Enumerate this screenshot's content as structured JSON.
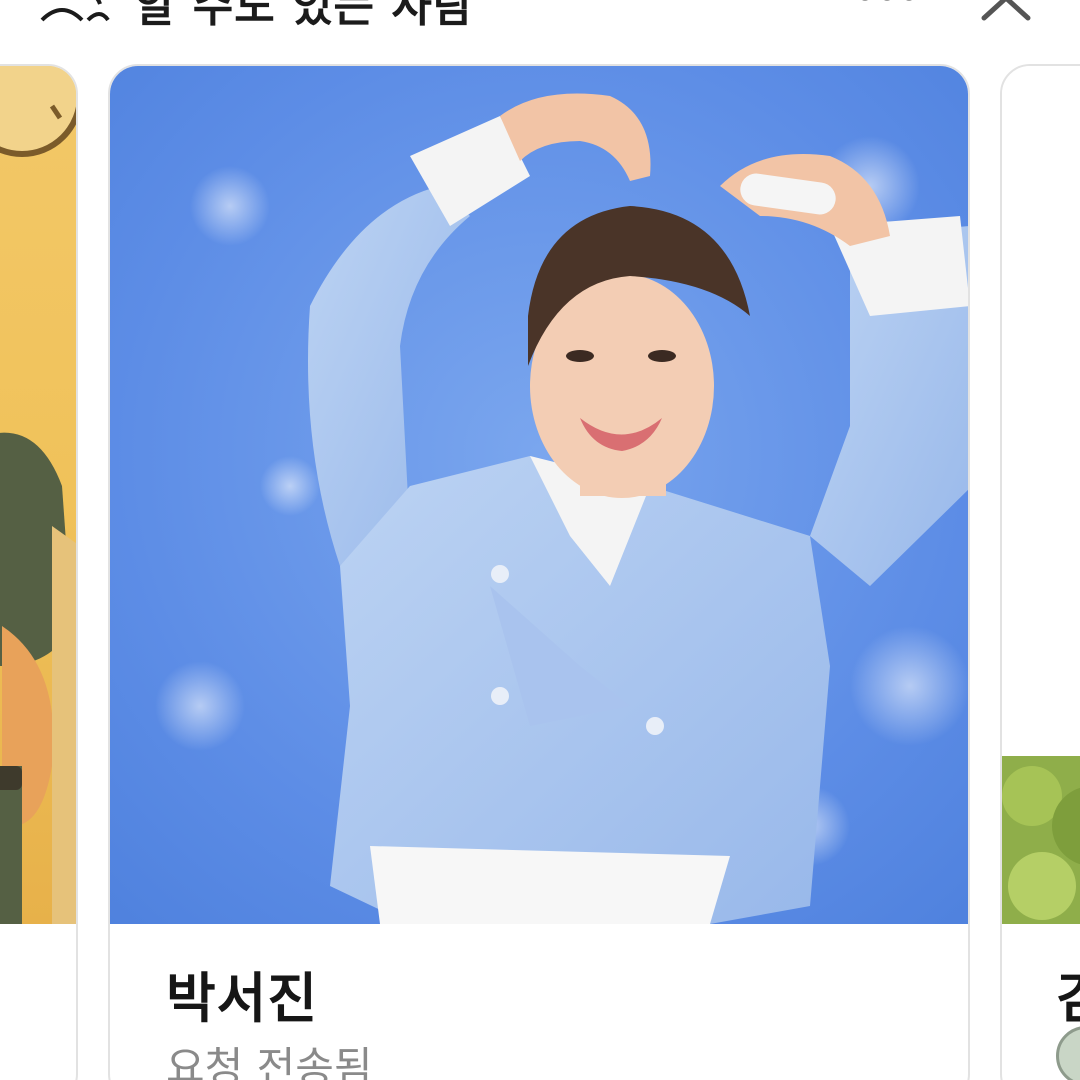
{
  "header": {
    "title": "알 수도 있는 사람",
    "icon": "people-icon",
    "more_icon": "more-horizontal-icon",
    "close_icon": "close-icon"
  },
  "cards": [
    {
      "position": "left-partial",
      "photo_desc": "illustration-photo"
    },
    {
      "position": "center",
      "name": "박서진",
      "status": "요청 전송됨",
      "photo_desc": "profile-photo"
    },
    {
      "position": "right-partial",
      "name": "김",
      "photo_desc": "profile-photo"
    }
  ],
  "colors": {
    "card_border": "#e2e2e2",
    "name_text": "#161616",
    "status_text": "#8a8a8a",
    "photo_blue": "#5d8de6"
  }
}
